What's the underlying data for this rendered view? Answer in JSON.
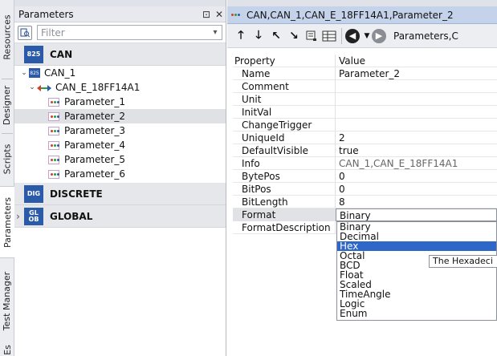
{
  "vertical_tabs": [
    "Resources",
    "Designer",
    "Scripts",
    "Parameters",
    "Test Manager",
    "Es"
  ],
  "panel": {
    "title": "Parameters",
    "pin_glyph": "⊡",
    "close_glyph": "✕",
    "filter_placeholder": "Filter",
    "groups": [
      {
        "icon": "825",
        "label": "CAN"
      },
      {
        "icon": "DIG",
        "label": "DISCRETE"
      },
      {
        "icon": "GL OB",
        "label": "GLOBAL"
      }
    ],
    "can_node": "CAN_1",
    "message_node": "CAN_E_18FF14A1",
    "parameters": [
      "Parameter_1",
      "Parameter_2",
      "Parameter_3",
      "Parameter_4",
      "Parameter_5",
      "Parameter_6"
    ]
  },
  "editor": {
    "tab_title": "CAN,CAN_1,CAN_E_18FF14A1,Parameter_2",
    "breadcrumb": "Parameters,C",
    "toolbar_icons": [
      "arrow-up-icon",
      "arrow-down-icon",
      "arrow-up-left-icon",
      "arrow-down-right-icon",
      "properties-icon",
      "grid-icon",
      "back-icon",
      "dropdown-icon",
      "forward-icon"
    ]
  },
  "grid": {
    "header": {
      "name": "Property",
      "value": "Value"
    },
    "rows": [
      {
        "name": "Name",
        "value": "Parameter_2"
      },
      {
        "name": "Comment",
        "value": ""
      },
      {
        "name": "Unit",
        "value": ""
      },
      {
        "name": "InitVal",
        "value": ""
      },
      {
        "name": "ChangeTrigger",
        "value": ""
      },
      {
        "name": "UniqueId",
        "value": "2"
      },
      {
        "name": "DefaultVisible",
        "value": "true"
      },
      {
        "name": "Info",
        "value": "CAN_1,CAN_E_18FF14A1"
      },
      {
        "name": "BytePos",
        "value": "0"
      },
      {
        "name": "BitPos",
        "value": "0"
      },
      {
        "name": "BitLength",
        "value": "8"
      },
      {
        "name": "Format",
        "value": "Binary"
      },
      {
        "name": "FormatDescription",
        "value": ""
      }
    ]
  },
  "dropdown": {
    "options": [
      "Binary",
      "Decimal",
      "Hex",
      "Octal",
      "BCD",
      "Float",
      "Scaled",
      "TimeAngle",
      "Logic",
      "Enum"
    ],
    "highlighted": "Hex"
  },
  "tooltip": "The Hexadeci",
  "colors": {
    "accent": "#2b5ba8",
    "highlight": "#2e67c7",
    "tab_active": "#c4d3ea"
  }
}
